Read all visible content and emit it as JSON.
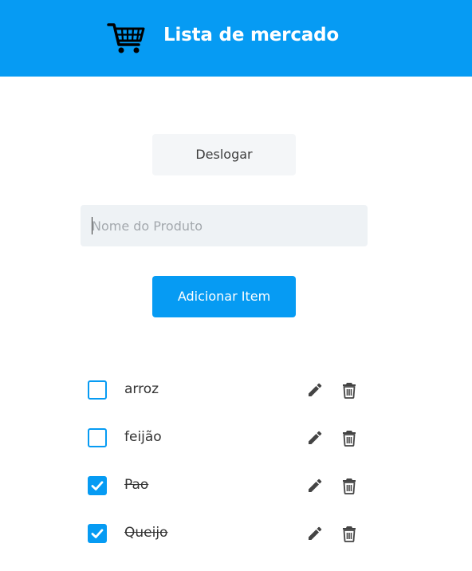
{
  "header": {
    "title": "Lista de mercado",
    "icon": "shopping-cart-icon",
    "background": "#069bf3"
  },
  "logout": {
    "label": "Deslogar"
  },
  "product_input": {
    "placeholder": "Nome do Produto",
    "value": ""
  },
  "add_button": {
    "label": "Adicionar Item"
  },
  "items": [
    {
      "label": "arroz",
      "checked": false
    },
    {
      "label": "feijão",
      "checked": false
    },
    {
      "label": "Pao",
      "checked": true
    },
    {
      "label": "Queijo",
      "checked": true
    }
  ],
  "colors": {
    "accent": "#069bf3",
    "icon": "#444444"
  }
}
